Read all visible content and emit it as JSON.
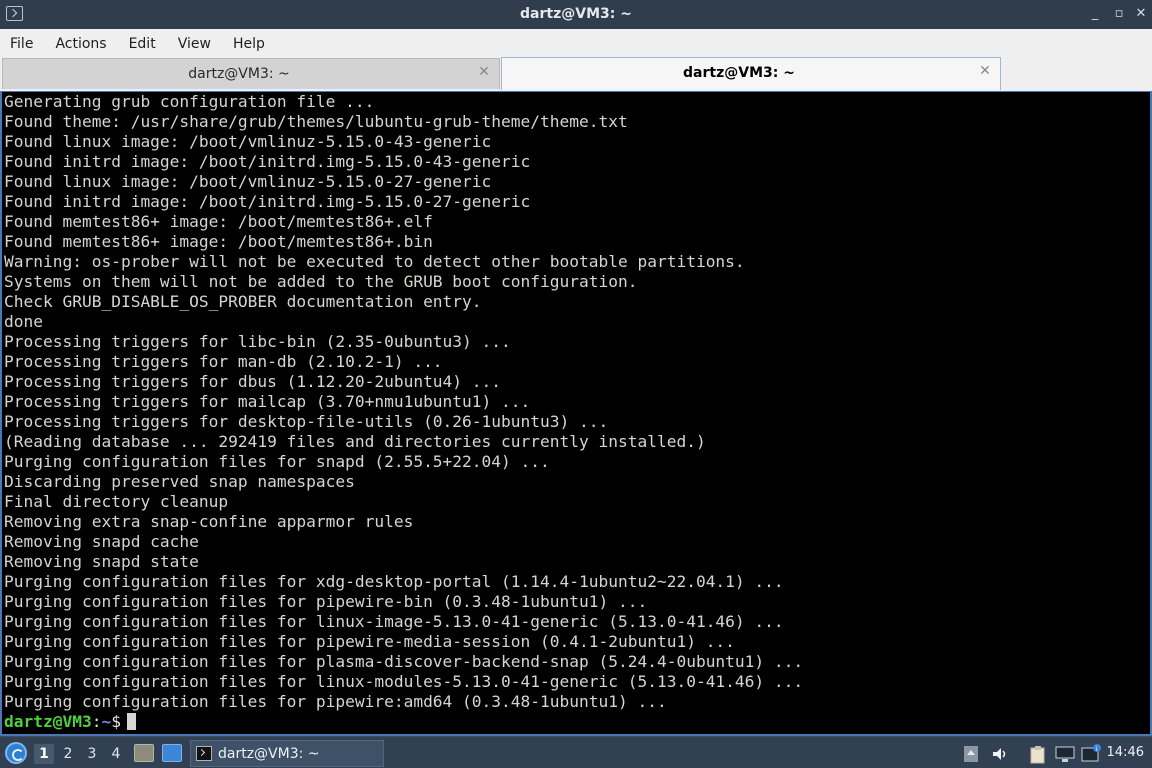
{
  "window": {
    "title": "dartz@VM3: ~",
    "minimize_glyph": "_",
    "restore_glyph": "▫",
    "close_glyph": "✕"
  },
  "menubar": {
    "items": [
      "File",
      "Actions",
      "Edit",
      "View",
      "Help"
    ]
  },
  "tabs": [
    {
      "label": "dartz@VM3: ~",
      "active": false,
      "close_glyph": "✕"
    },
    {
      "label": "dartz@VM3: ~",
      "active": true,
      "close_glyph": "✕"
    }
  ],
  "terminal": {
    "lines": [
      "Generating grub configuration file ...",
      "Found theme: /usr/share/grub/themes/lubuntu-grub-theme/theme.txt",
      "Found linux image: /boot/vmlinuz-5.15.0-43-generic",
      "Found initrd image: /boot/initrd.img-5.15.0-43-generic",
      "Found linux image: /boot/vmlinuz-5.15.0-27-generic",
      "Found initrd image: /boot/initrd.img-5.15.0-27-generic",
      "Found memtest86+ image: /boot/memtest86+.elf",
      "Found memtest86+ image: /boot/memtest86+.bin",
      "Warning: os-prober will not be executed to detect other bootable partitions.",
      "Systems on them will not be added to the GRUB boot configuration.",
      "Check GRUB_DISABLE_OS_PROBER documentation entry.",
      "done",
      "Processing triggers for libc-bin (2.35-0ubuntu3) ...",
      "Processing triggers for man-db (2.10.2-1) ...",
      "Processing triggers for dbus (1.12.20-2ubuntu4) ...",
      "Processing triggers for mailcap (3.70+nmu1ubuntu1) ...",
      "Processing triggers for desktop-file-utils (0.26-1ubuntu3) ...",
      "(Reading database ... 292419 files and directories currently installed.)",
      "Purging configuration files for snapd (2.55.5+22.04) ...",
      "Discarding preserved snap namespaces",
      "Final directory cleanup",
      "Removing extra snap-confine apparmor rules",
      "Removing snapd cache",
      "Removing snapd state",
      "Purging configuration files for xdg-desktop-portal (1.14.4-1ubuntu2~22.04.1) ...",
      "Purging configuration files for pipewire-bin (0.3.48-1ubuntu1) ...",
      "Purging configuration files for linux-image-5.13.0-41-generic (5.13.0-41.46) ...",
      "Purging configuration files for pipewire-media-session (0.4.1-2ubuntu1) ...",
      "Purging configuration files for plasma-discover-backend-snap (5.24.4-0ubuntu1) ...",
      "Purging configuration files for linux-modules-5.13.0-41-generic (5.13.0-41.46) ...",
      "Purging configuration files for pipewire:amd64 (0.3.48-1ubuntu1) ..."
    ],
    "prompt": {
      "user_host": "dartz@VM3",
      "separator": ":",
      "path": "~",
      "sign": "$"
    }
  },
  "taskbar": {
    "desktops": [
      "1",
      "2",
      "3",
      "4"
    ],
    "current_desktop": "1",
    "task_label": "dartz@VM3: ~",
    "clock": "14:46",
    "tray_icons": [
      "show-hidden-icon",
      "volume-icon",
      "clipboard-icon",
      "network-icon",
      "notification-icon"
    ]
  },
  "colors": {
    "prompt_user": "#4fd13e",
    "prompt_path": "#6d8fd6",
    "terminal_bg": "#000000",
    "terminal_fg": "#d3d7cf",
    "focus_border": "#4a78b5"
  }
}
